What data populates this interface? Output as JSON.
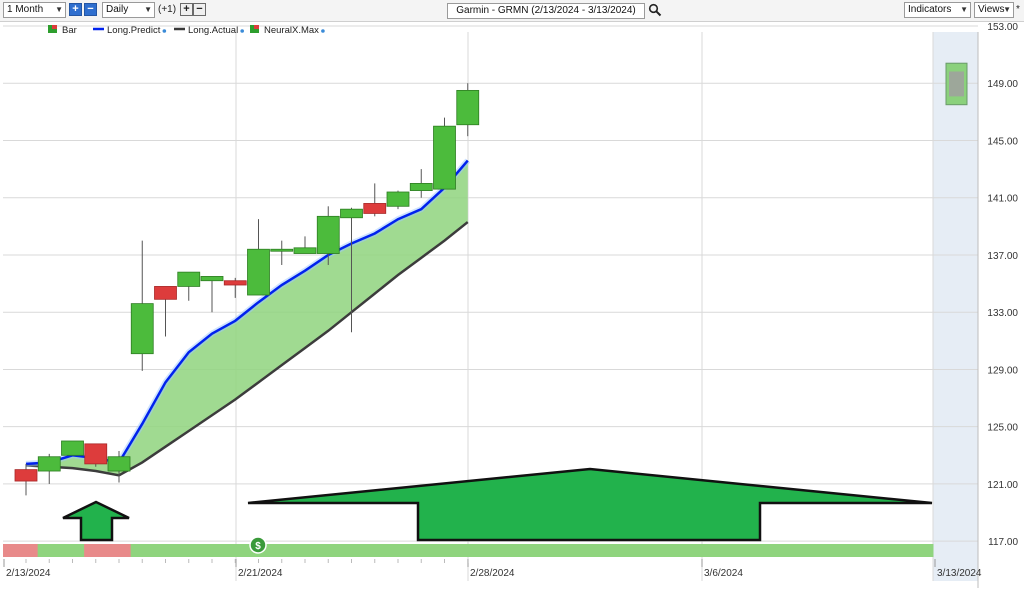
{
  "toolbar": {
    "period": "1 Month",
    "interval": "Daily",
    "offset": "(+1)",
    "title": "Garmin - GRMN (2/13/2024 - 3/13/2024)",
    "indicators": "Indicators",
    "views": "Views",
    "views_star": "*",
    "plus": "+",
    "minus": "−",
    "icons": [
      "plus-icon",
      "minus-icon",
      "search-icon",
      "chevron-down-icon"
    ]
  },
  "legend": [
    {
      "label": "Bar",
      "color": "#2e9e2e"
    },
    {
      "label": "Long.Predict",
      "color": "#0022ee"
    },
    {
      "label": "Long.Actual",
      "color": "#3a3a3a"
    },
    {
      "label": "NeuralX.Max",
      "color": "#2e9e2e"
    }
  ],
  "chart_data": {
    "type": "candlestick",
    "ylim": [
      117,
      154
    ],
    "yticks": [
      "153.00",
      "149.00",
      "145.00",
      "141.00",
      "137.00",
      "133.00",
      "129.00",
      "125.00",
      "121.00",
      "117.00"
    ],
    "xticks": [
      "2/13/2024",
      "2/21/2024",
      "2/28/2024",
      "3/6/2024",
      "3/13/2024"
    ],
    "candles": [
      {
        "open": 122.0,
        "high": 122.4,
        "low": 120.2,
        "close": 121.2
      },
      {
        "open": 121.9,
        "high": 123.1,
        "low": 121.0,
        "close": 122.9
      },
      {
        "open": 123.0,
        "high": 124.0,
        "low": 123.0,
        "close": 124.0
      },
      {
        "open": 123.8,
        "high": 123.8,
        "low": 122.2,
        "close": 122.4
      },
      {
        "open": 121.9,
        "high": 123.3,
        "low": 121.1,
        "close": 122.9
      },
      {
        "open": 130.1,
        "high": 138.0,
        "low": 128.9,
        "close": 133.6
      },
      {
        "open": 134.8,
        "high": 134.8,
        "low": 131.3,
        "close": 133.9
      },
      {
        "open": 134.8,
        "high": 135.8,
        "low": 133.8,
        "close": 135.8
      },
      {
        "open": 135.2,
        "high": 135.5,
        "low": 133.0,
        "close": 135.5
      },
      {
        "open": 135.2,
        "high": 135.4,
        "low": 134.0,
        "close": 134.9
      },
      {
        "open": 134.2,
        "high": 139.5,
        "low": 134.2,
        "close": 137.4
      },
      {
        "open": 137.4,
        "high": 138.0,
        "low": 136.3,
        "close": 137.4
      },
      {
        "open": 137.1,
        "high": 138.3,
        "low": 137.1,
        "close": 137.5
      },
      {
        "open": 137.1,
        "high": 140.4,
        "low": 136.3,
        "close": 139.7
      },
      {
        "open": 139.6,
        "high": 140.3,
        "low": 131.6,
        "close": 140.2
      },
      {
        "open": 140.6,
        "high": 142.0,
        "low": 139.7,
        "close": 139.9
      },
      {
        "open": 140.4,
        "high": 141.5,
        "low": 140.2,
        "close": 141.4
      },
      {
        "open": 141.5,
        "high": 143.0,
        "low": 141.0,
        "close": 142.0
      },
      {
        "open": 141.6,
        "high": 146.6,
        "low": 141.6,
        "close": 146.0
      },
      {
        "open": 146.1,
        "high": 149.0,
        "low": 145.3,
        "close": 148.5
      }
    ],
    "projection": {
      "open": 147.5,
      "close": 150.4
    },
    "long_predict": [
      122.4,
      122.5,
      123.0,
      122.8,
      122.5,
      125.2,
      128.1,
      130.2,
      131.5,
      132.4,
      133.7,
      134.9,
      135.9,
      137.0,
      137.8,
      138.5,
      139.5,
      140.2,
      141.7,
      143.6
    ],
    "long_actual": [
      122.3,
      122.2,
      122.1,
      121.9,
      121.6,
      122.5,
      123.6,
      124.7,
      125.8,
      126.9,
      128.1,
      129.3,
      130.5,
      131.7,
      133.0,
      134.3,
      135.6,
      136.8,
      138.0,
      139.3
    ],
    "signal_bar": [
      "red",
      "green",
      "green",
      "red",
      "red",
      "green",
      "green",
      "green",
      "green",
      "green",
      "green",
      "green",
      "green",
      "green",
      "green",
      "green",
      "green",
      "green",
      "green",
      "green"
    ],
    "colors": {
      "up": "#4cbb3c",
      "down": "#dd3c3c",
      "predict": "#0022ee",
      "actual": "#3c3c3c",
      "band": "#8fd47e",
      "signal_green": "#8fd47e",
      "signal_red": "#e88a8a",
      "projection_bg": "#e6edf5"
    }
  }
}
